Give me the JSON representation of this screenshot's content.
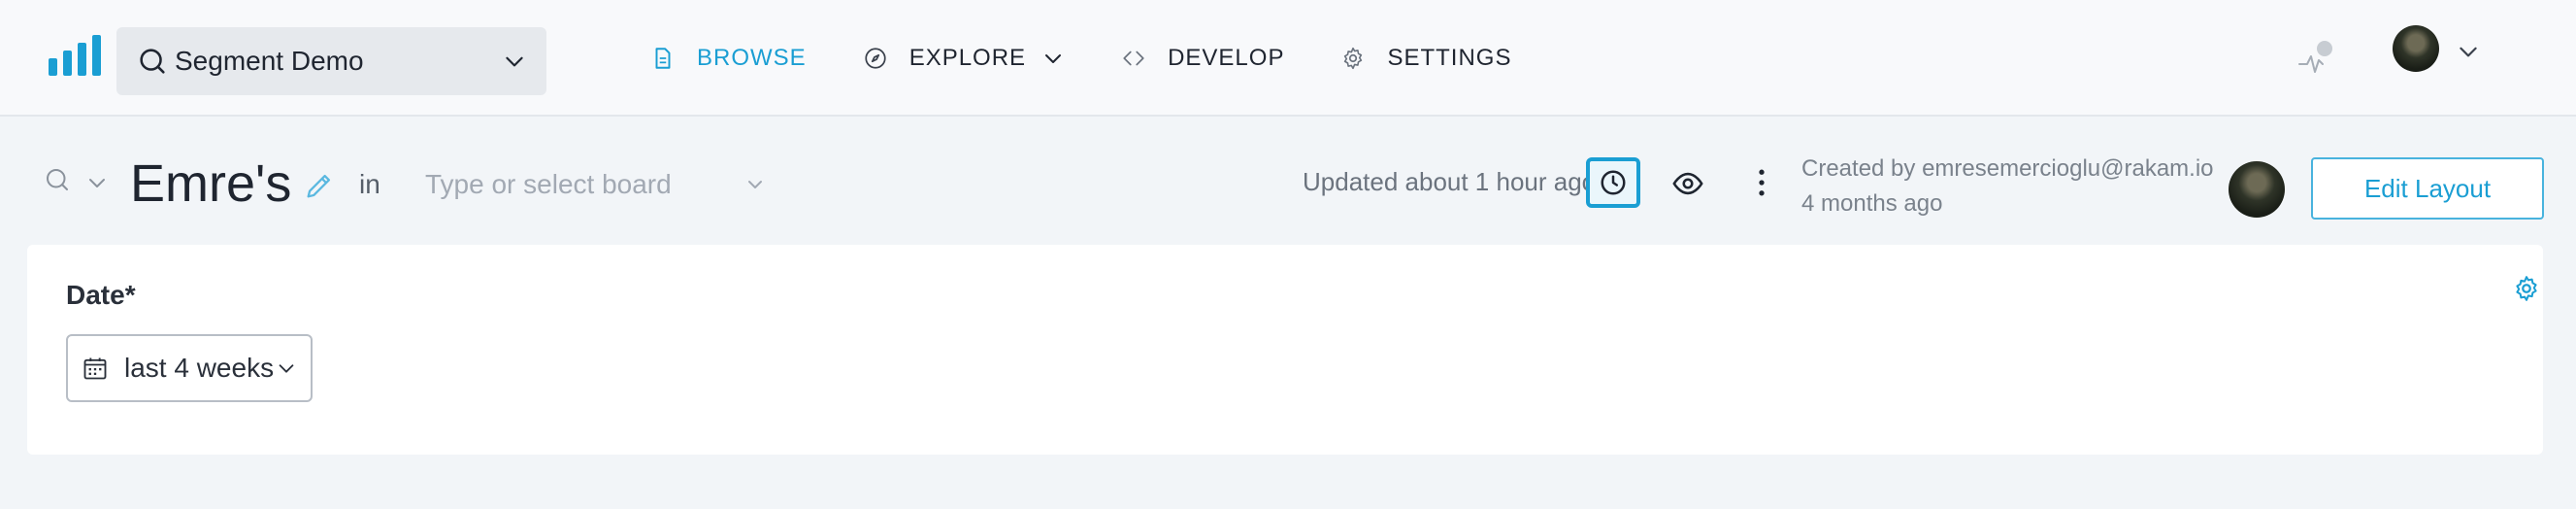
{
  "topbar": {
    "project": {
      "label": "Segment Demo"
    },
    "nav": [
      {
        "label": "BROWSE",
        "icon": "document-icon",
        "active": true
      },
      {
        "label": "EXPLORE",
        "icon": "compass-icon",
        "active": false
      },
      {
        "label": "DEVELOP",
        "icon": "code-icon",
        "active": false
      },
      {
        "label": "SETTINGS",
        "icon": "gear-icon",
        "active": false
      }
    ]
  },
  "report": {
    "title": "Emre's",
    "in_label": "in",
    "board_placeholder": "Type or select board",
    "updated": "Updated about 1 hour ago",
    "created_by": "Created by emresemercioglu@rakam.io",
    "created_when": "4 months ago",
    "edit_layout_label": "Edit Layout"
  },
  "filters": {
    "date_label": "Date*",
    "date_value": "last 4 weeks"
  },
  "colors": {
    "accent": "#1a9ed3",
    "background": "#f2f5f8",
    "card": "#ffffff"
  }
}
